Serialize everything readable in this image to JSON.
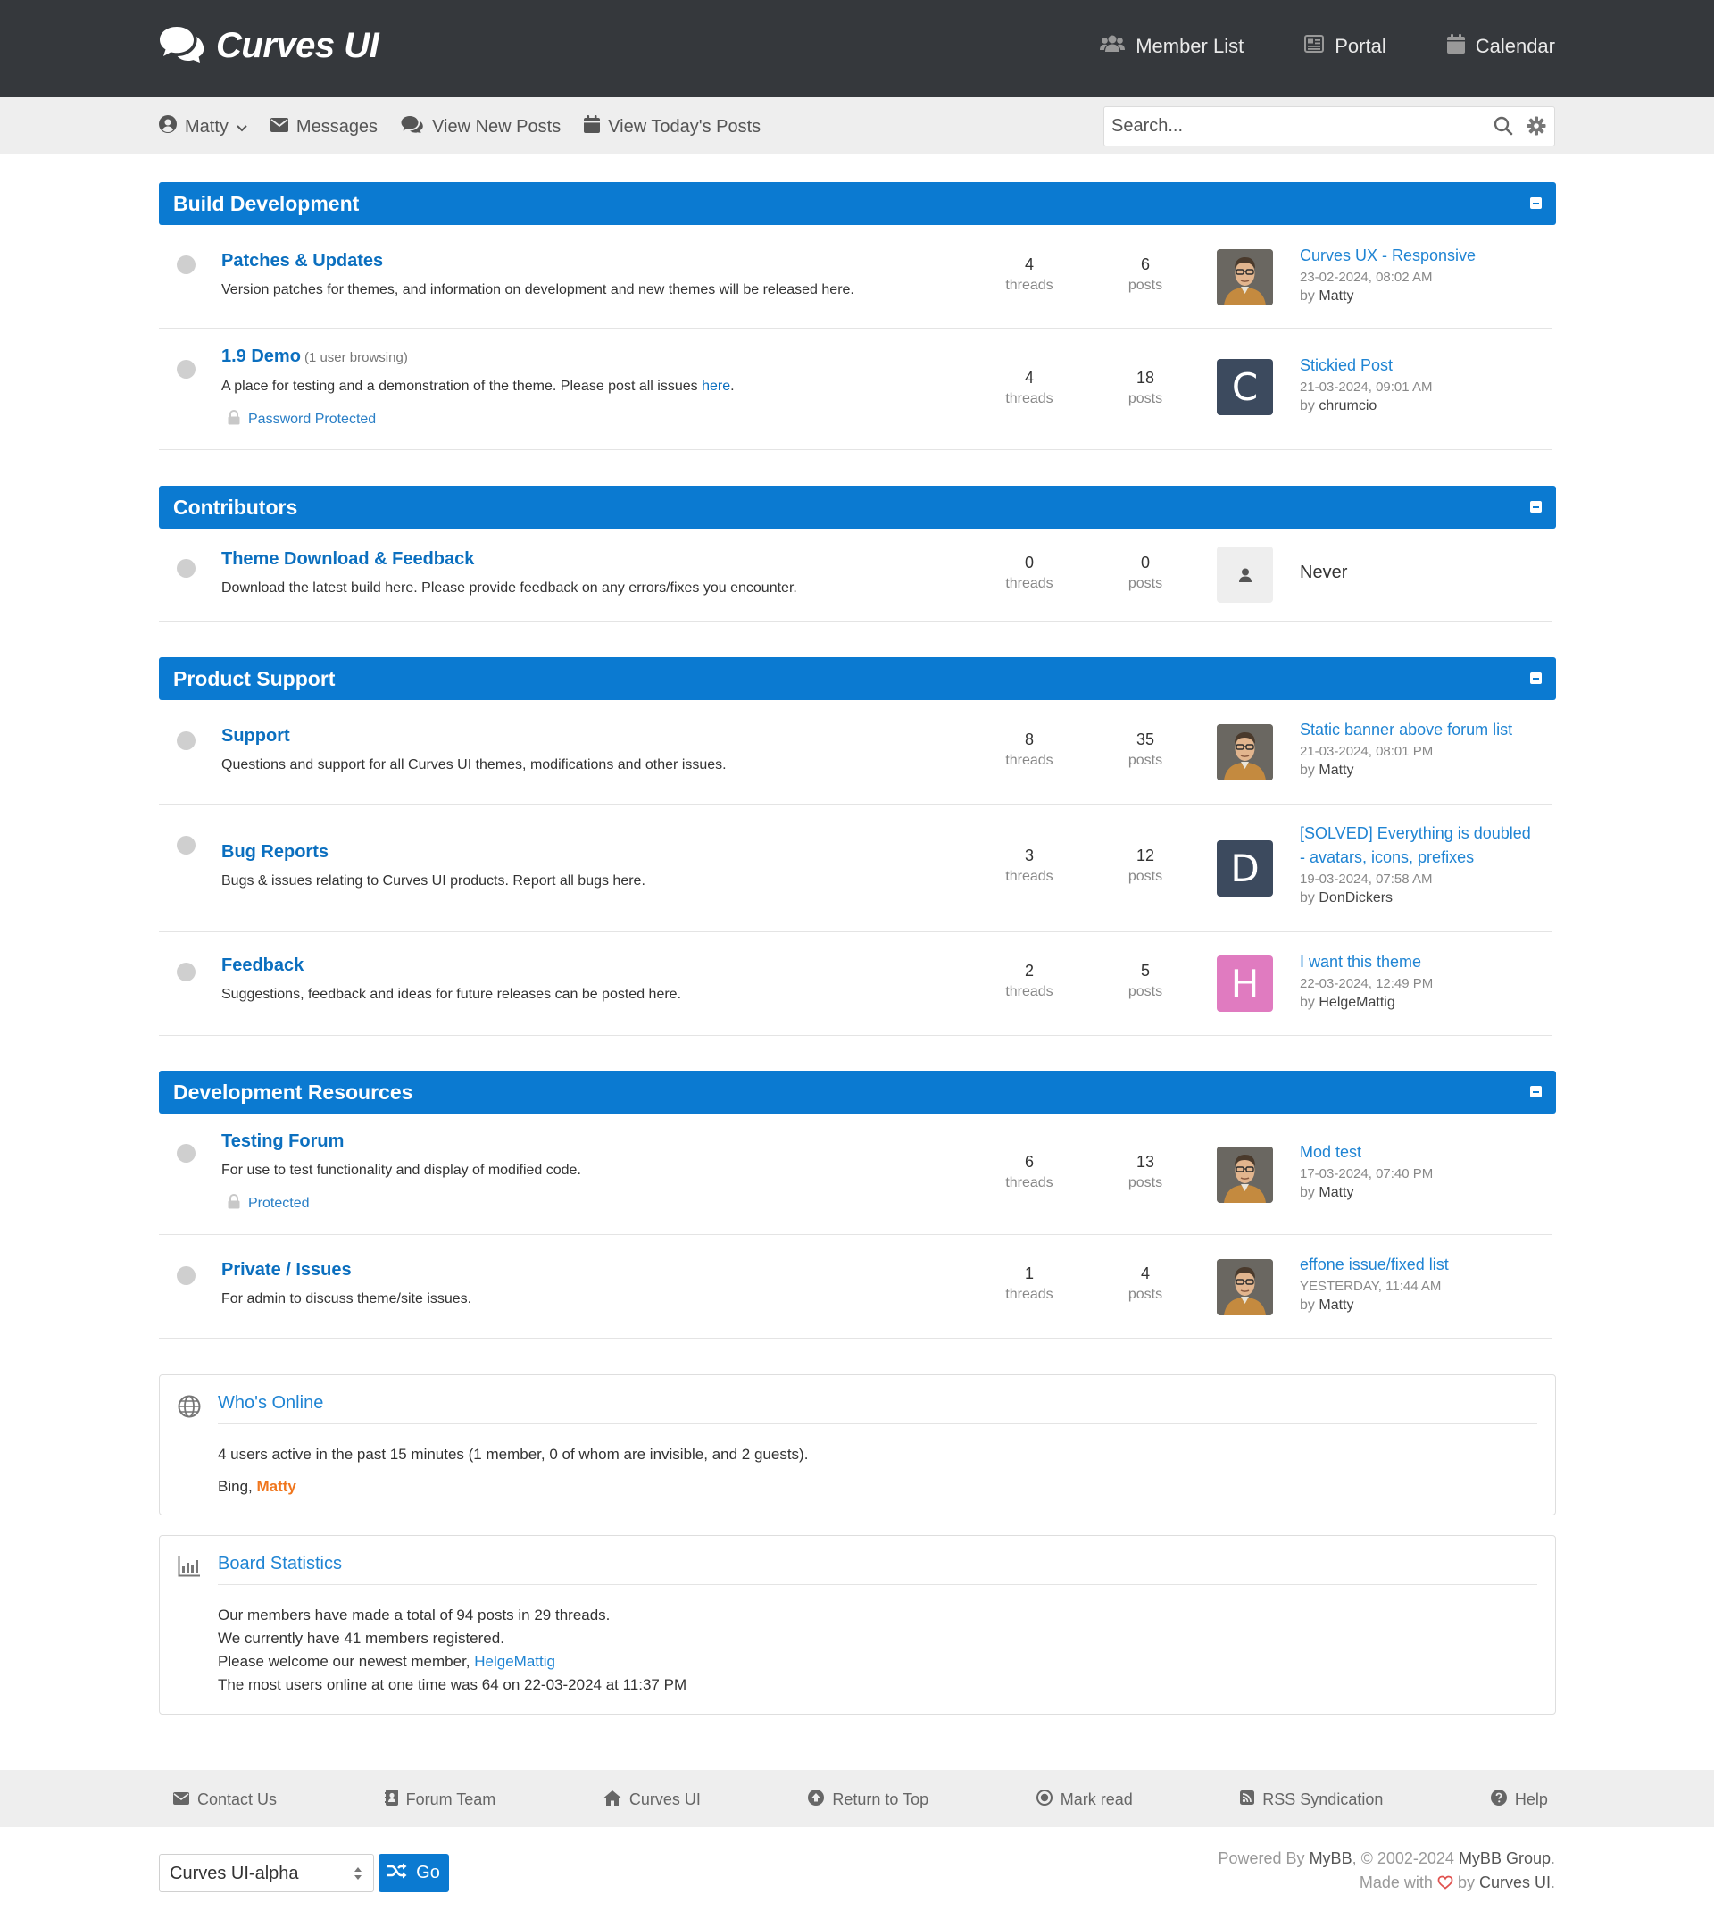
{
  "header": {
    "logo_text": "Curves UI",
    "nav": [
      "Member List",
      "Portal",
      "Calendar"
    ]
  },
  "usernav": {
    "user": "Matty",
    "messages": "Messages",
    "new_posts": "View New Posts",
    "todays_posts": "View Today's Posts"
  },
  "search": {
    "placeholder": "Search..."
  },
  "labels": {
    "threads": "threads",
    "posts": "posts",
    "by": "by"
  },
  "categories": [
    {
      "title": "Build Development",
      "forums": [
        {
          "title": "Patches & Updates",
          "desc": "Version patches for themes, and information on development and new themes will be released here.",
          "threads": "4",
          "posts": "6",
          "last_subject": "Curves UX - Responsive",
          "last_date": "23-02-2024, 08:02 AM",
          "last_by": "Matty"
        },
        {
          "title": "1.9 Demo",
          "browsing": "(1 user browsing)",
          "desc": "A place for testing and a demonstration of the theme. Please post all issues ",
          "desc_link": "here",
          "desc_end": ".",
          "lock": "Password Protected",
          "threads": "4",
          "posts": "18",
          "avatar_letter": "C",
          "last_subject": "Stickied Post",
          "last_date": "21-03-2024, 09:01 AM",
          "last_by": "chrumcio"
        }
      ]
    },
    {
      "title": "Contributors",
      "forums": [
        {
          "title": "Theme Download & Feedback",
          "desc": "Download the latest build here. Please provide feedback on any errors/fixes you encounter.",
          "threads": "0",
          "posts": "0",
          "last_never": "Never"
        }
      ]
    },
    {
      "title": "Product Support",
      "forums": [
        {
          "title": "Support",
          "desc": "Questions and support for all Curves UI themes, modifications and other issues.",
          "threads": "8",
          "posts": "35",
          "last_subject": "Static banner above forum list",
          "last_date": "21-03-2024, 08:01 PM",
          "last_by": "Matty"
        },
        {
          "title": "Bug Reports",
          "desc": "Bugs & issues relating to Curves UI products. Report all bugs here.",
          "threads": "3",
          "posts": "12",
          "avatar_letter": "D",
          "last_subject_1": "[SOLVED] Everything is doubled",
          "last_subject_2": "- avatars, icons, prefixes",
          "last_date": "19-03-2024, 07:58 AM",
          "last_by": "DonDickers"
        },
        {
          "title": "Feedback",
          "desc": "Suggestions, feedback and ideas for future releases can be posted here.",
          "threads": "2",
          "posts": "5",
          "avatar_letter": "H",
          "last_subject": "I want this theme",
          "last_date": "22-03-2024, 12:49 PM",
          "last_by": "HelgeMattig"
        }
      ]
    },
    {
      "title": "Development Resources",
      "forums": [
        {
          "title": "Testing Forum",
          "desc": "For use to test functionality and display of modified code.",
          "lock": "Protected",
          "threads": "6",
          "posts": "13",
          "last_subject": "Mod test",
          "last_date": "17-03-2024, 07:40 PM",
          "last_by": "Matty"
        },
        {
          "title": "Private / Issues",
          "desc": "For admin to discuss theme/site issues.",
          "threads": "1",
          "posts": "4",
          "last_subject": "effone issue/fixed list",
          "last_date": "YESTERDAY, 11:44 AM",
          "last_by": "Matty"
        }
      ]
    }
  ],
  "whos_online": {
    "title": "Who's Online",
    "summary": "4 users active in the past 15 minutes (1 member, 0 of whom are invisible, and 2 guests).",
    "bots": "Bing, ",
    "member": "Matty"
  },
  "board_stats": {
    "title": "Board Statistics",
    "line1": "Our members have made a total of 94 posts in 29 threads.",
    "line2": "We currently have 41 members registered.",
    "line3": "Please welcome our newest member, ",
    "newest_member": "HelgeMattig",
    "line4": "The most users online at one time was 64 on 22-03-2024 at 11:37 PM"
  },
  "footer": {
    "nav": [
      "Contact Us",
      "Forum Team",
      "Curves UI",
      "Return to Top",
      "Mark read",
      "RSS Syndication",
      "Help"
    ],
    "theme_selected": "Curves UI-alpha",
    "go_label": "Go",
    "powered_prefix": "Powered By ",
    "powered_mybb": "MyBB",
    "powered_mid": ", © 2002-2024 ",
    "powered_group": "MyBB Group",
    "powered_end": ".",
    "made_prefix": "Made with ",
    "made_by": " by ",
    "made_brand": "Curves UI",
    "made_end": "."
  },
  "colors": {
    "accent": "#0b7ad1",
    "topbar": "#35383c",
    "avatar_c": "#3c4a5e",
    "avatar_d": "#3c4a5e",
    "avatar_h": "#e07bc0",
    "online_member": "#f0761d"
  }
}
